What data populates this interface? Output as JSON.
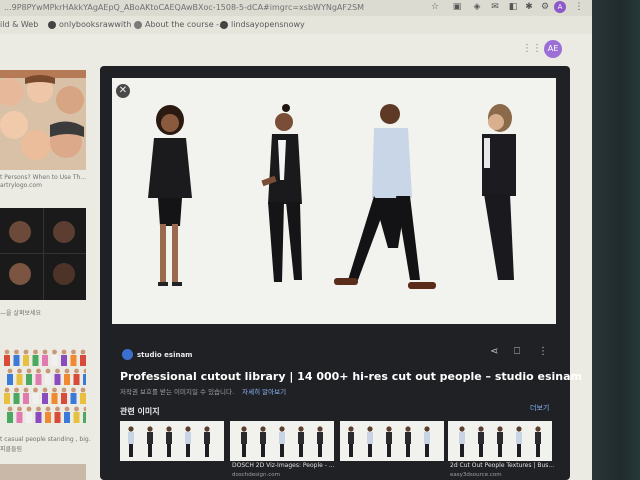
{
  "browser": {
    "url_text": "...9P8PYwMPkrHAkkYAgAEpQ_ABoAKtoCAEQAwBXoc-1508-5-dCA#imgrc=xsbWYNgAF2SM",
    "account_initial": "A"
  },
  "bookmarks": [
    {
      "label": "ild & Web",
      "icon": "bookmark-icon"
    },
    {
      "label": "onlybooksrawwith",
      "icon": "github-icon"
    },
    {
      "label": "About the course -...",
      "icon": "globe-icon"
    },
    {
      "label": "lindsayopensnowy",
      "icon": "github-icon"
    }
  ],
  "header": {
    "account_initial": "AE"
  },
  "left_results": {
    "items": [
      {
        "caption": "t Persons? When to Use Th...",
        "source": "artrylogo.com"
      },
      {
        "caption": "—을 살펴보세요",
        "source": ""
      },
      {
        "caption": "t casual people standing , big...",
        "source": "피클들림"
      }
    ]
  },
  "viewer": {
    "source_name": "studio esinam",
    "title": "Professional cutout library | 14 000+ hi-res cut out people – studio esinam",
    "notice": "저작권 보호를 받는 이미지일 수 있습니다.",
    "notice_more": "자세히 알아보기",
    "related_heading": "관련 이미지",
    "more_label": "더보기",
    "related": [
      {
        "caption": "",
        "source": ""
      },
      {
        "caption": "DOSCH 2D Viz-Images: People - ...",
        "source": "doschdesign.com"
      },
      {
        "caption": "",
        "source": ""
      },
      {
        "caption": "2d Cut Out People Textures | Bus...",
        "source": "easy3dsource.com"
      }
    ]
  },
  "colors": {
    "viewer_bg": "#202124",
    "link": "#8ab4f8",
    "source_icon": "#3a6fcf"
  }
}
